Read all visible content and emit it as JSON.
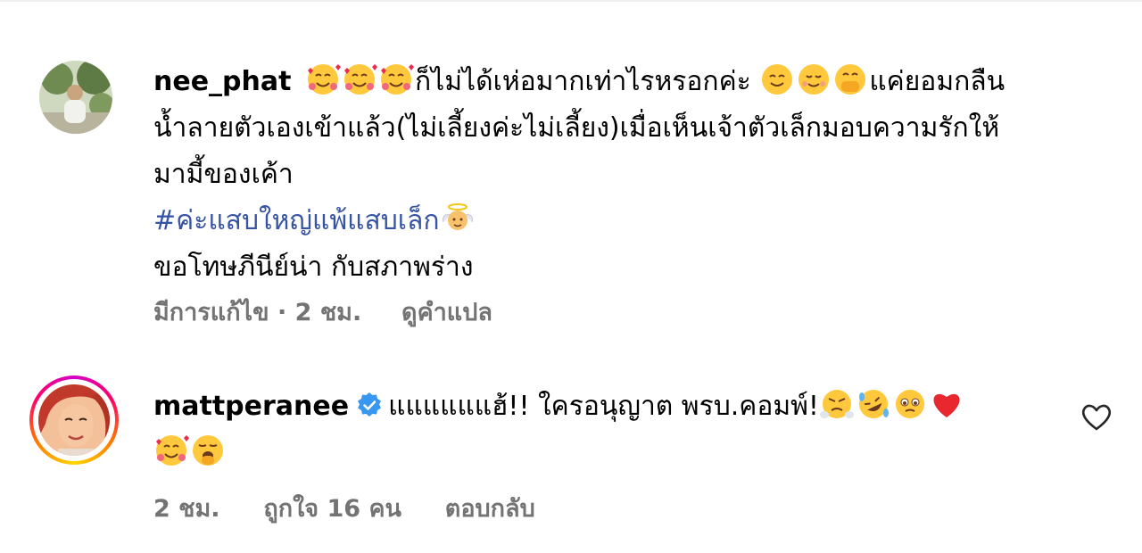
{
  "comments": [
    {
      "username": "nee_phat",
      "text_line1_a": "ก็ไม่ได้เห่อมากเท่าไรหรอกค่ะ",
      "text_line1_b": "แค่ยอมกลืน",
      "text_line2": "น้ำลายตัวเองเข้าแล้ว(ไม่เลี้ยงค่ะไม่เลี้ยง)เมื่อเห็นเจ้าตัวเล็กมอบความรักให้",
      "text_line3": "มามี้ของเค้า",
      "hashtag": "#ค่ะแสบใหญ่แพ้แสบเล็ก",
      "text_line5": "ขอโทษภีนีย์น่า กับสภาพร่าง",
      "meta_edited": "มีการแก้ไข · 2 ชม.",
      "meta_translate": "ดูคำแปล"
    },
    {
      "username": "mattperanee",
      "text": "แแแแแแฮ้!! ใครอนุญาต พรบ.คอมพ์!",
      "meta_time": "2 ชม.",
      "meta_likes": "ถูกใจ 16 คน",
      "meta_reply": "ตอบกลับ"
    }
  ],
  "icons": {
    "verified_color": "#3897f0",
    "heart_icon": "heart-outline-icon"
  }
}
